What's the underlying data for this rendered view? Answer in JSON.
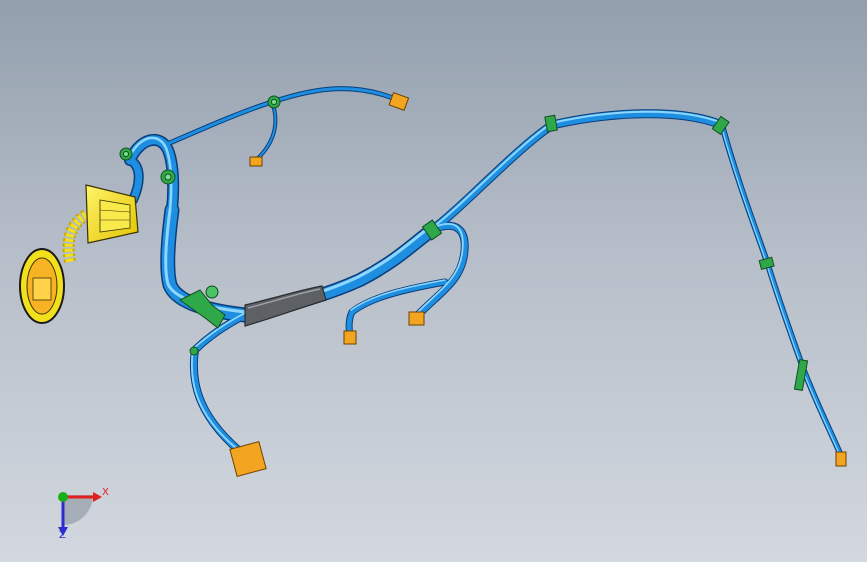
{
  "triad": {
    "x_label": "X",
    "z_label": "Z",
    "x_color": "#e02020",
    "y_color": "#18b018",
    "z_color": "#2c2cd0"
  },
  "colors": {
    "background_top": "#939fad",
    "background_bottom": "#d3d8df",
    "wire_main": "#1e8fe0",
    "wire_highlight": "#8fd6ff",
    "wire_outline": "#0a3d7a",
    "clip": "#2fa84a",
    "connector": "#f3a521",
    "housing": "#f3e01c",
    "sleeve": "#5d6166"
  },
  "icons": [
    "triad-icon",
    "wire-harness-model"
  ]
}
